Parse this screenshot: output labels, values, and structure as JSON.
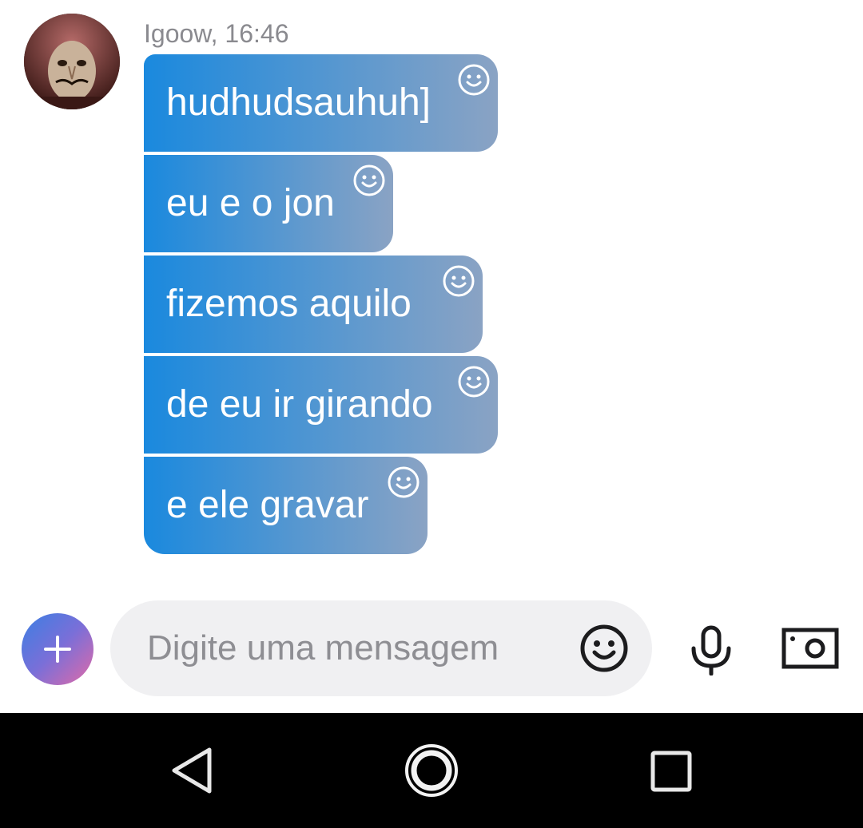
{
  "conversation": {
    "sender_line": "Igoow, 16:46",
    "messages": [
      {
        "text": "hudhudsauhuh]"
      },
      {
        "text": "eu e o jon"
      },
      {
        "text": "fizemos aquilo"
      },
      {
        "text": "de eu ir girando"
      },
      {
        "text": "e ele gravar"
      }
    ]
  },
  "composer": {
    "placeholder": "Digite uma mensagem",
    "add_icon": "plus-icon",
    "emoji_icon": "smiley-icon",
    "mic_icon": "microphone-icon",
    "camera_icon": "camera-icon"
  },
  "navbar": {
    "back_icon": "back-triangle-icon",
    "home_icon": "home-circle-icon",
    "recents_icon": "recents-square-icon"
  },
  "colors": {
    "bubble_start": "#1a89de",
    "bubble_end": "#8aa3c4",
    "input_bg": "#f0f0f2",
    "placeholder": "#8e8e93",
    "navbar_bg": "#000000"
  }
}
